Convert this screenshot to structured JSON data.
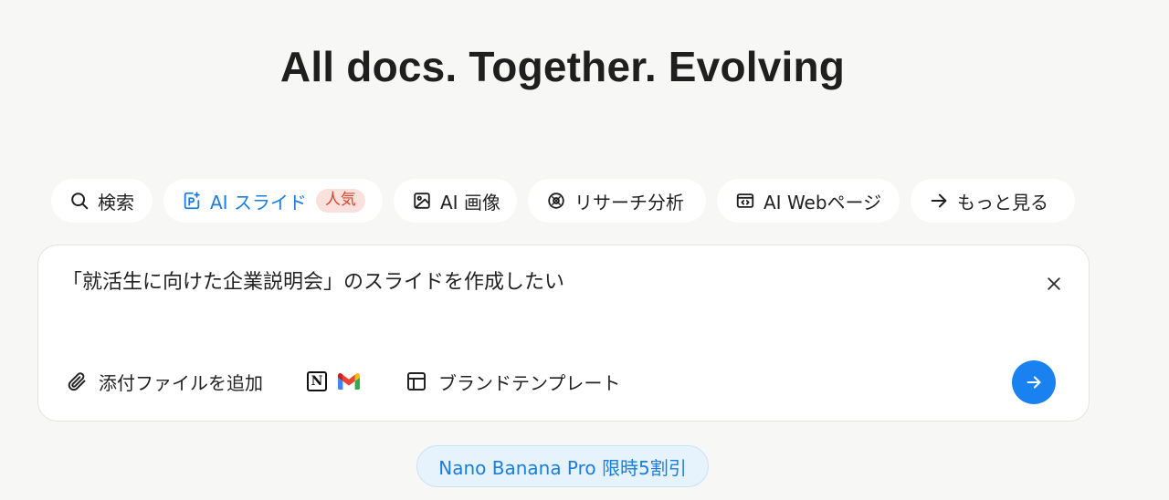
{
  "hero": {
    "title": "All docs. Together. Evolving"
  },
  "tabs": [
    {
      "label": "検索",
      "icon": "search-icon"
    },
    {
      "label": "AI スライド",
      "icon": "slides-icon",
      "badge": "人気",
      "active": true
    },
    {
      "label": "AI 画像",
      "icon": "image-icon"
    },
    {
      "label": "リサーチ分析",
      "icon": "research-icon"
    },
    {
      "label": "AI Webページ",
      "icon": "webpage-icon"
    },
    {
      "label": "もっと見る",
      "icon": "arrow-right-icon"
    }
  ],
  "prompt": {
    "value": "「就活生に向けた企業説明会」のスライドを作成したい",
    "attach_label": "添付ファイルを追加",
    "brand_template_label": "ブランドテンプレート",
    "integrations": [
      "notion-icon",
      "gmail-icon"
    ]
  },
  "promo": {
    "label": "Nano Banana Pro 限時5割引"
  },
  "colors": {
    "accent": "#1a82f0",
    "badge_bg": "#fbe1dc",
    "badge_text": "#d9452f",
    "background": "#f7f7f5",
    "promo_bg": "#e7f3fc"
  }
}
